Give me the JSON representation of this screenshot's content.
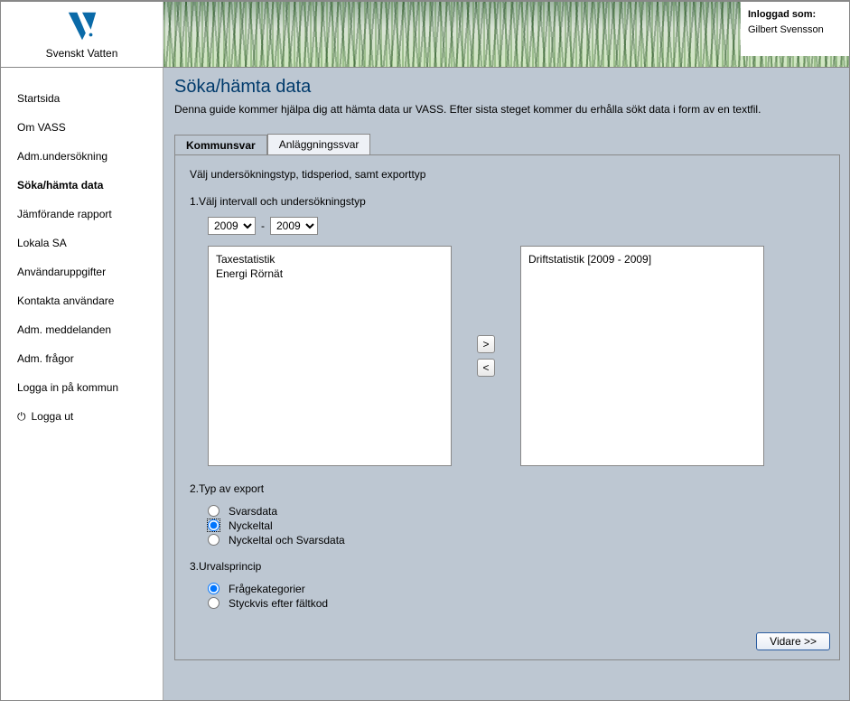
{
  "brand": {
    "name": "Svenskt Vatten"
  },
  "login": {
    "label": "Inloggad som:",
    "user": "Gilbert Svensson"
  },
  "nav": {
    "items": [
      {
        "label": "Startsida"
      },
      {
        "label": "Om VASS"
      },
      {
        "label": "Adm.undersökning"
      },
      {
        "label": "Söka/hämta data",
        "active": true
      },
      {
        "label": "Jämförande rapport"
      },
      {
        "label": "Lokala SA"
      },
      {
        "label": "Användaruppgifter"
      },
      {
        "label": "Kontakta användare"
      },
      {
        "label": "Adm. meddelanden"
      },
      {
        "label": "Adm. frågor"
      },
      {
        "label": "Logga in på kommun"
      },
      {
        "label": "Logga ut",
        "logout": true
      }
    ]
  },
  "page": {
    "title": "Söka/hämta data",
    "description": "Denna guide kommer hjälpa dig att hämta data ur VASS. Efter sista steget kommer du erhålla sökt data i form av en textfil."
  },
  "tabs": {
    "active": "Kommunsvar",
    "items": [
      {
        "label": "Kommunsvar"
      },
      {
        "label": "Anläggningssvar"
      }
    ]
  },
  "panel": {
    "section_title": "Välj undersökningstyp, tidsperiod, samt exporttyp",
    "step1": {
      "label": "1.Välj intervall och undersökningstyp",
      "year_from": "2009",
      "year_to": "2009",
      "separator": "-",
      "left_items": [
        "Taxestatistik",
        "Energi Rörnät"
      ],
      "right_items": [
        "Driftstatistik [2009 - 2009]"
      ],
      "move_right_label": ">",
      "move_left_label": "<"
    },
    "step2": {
      "label": "2.Typ av export",
      "options": [
        {
          "label": "Svarsdata",
          "checked": false
        },
        {
          "label": "Nyckeltal",
          "checked": true
        },
        {
          "label": "Nyckeltal och Svarsdata",
          "checked": false
        }
      ]
    },
    "step3": {
      "label": "3.Urvalsprincip",
      "options": [
        {
          "label": "Frågekategorier",
          "checked": true
        },
        {
          "label": "Styckvis efter fältkod",
          "checked": false
        }
      ]
    },
    "next_button": "Vidare >>"
  }
}
